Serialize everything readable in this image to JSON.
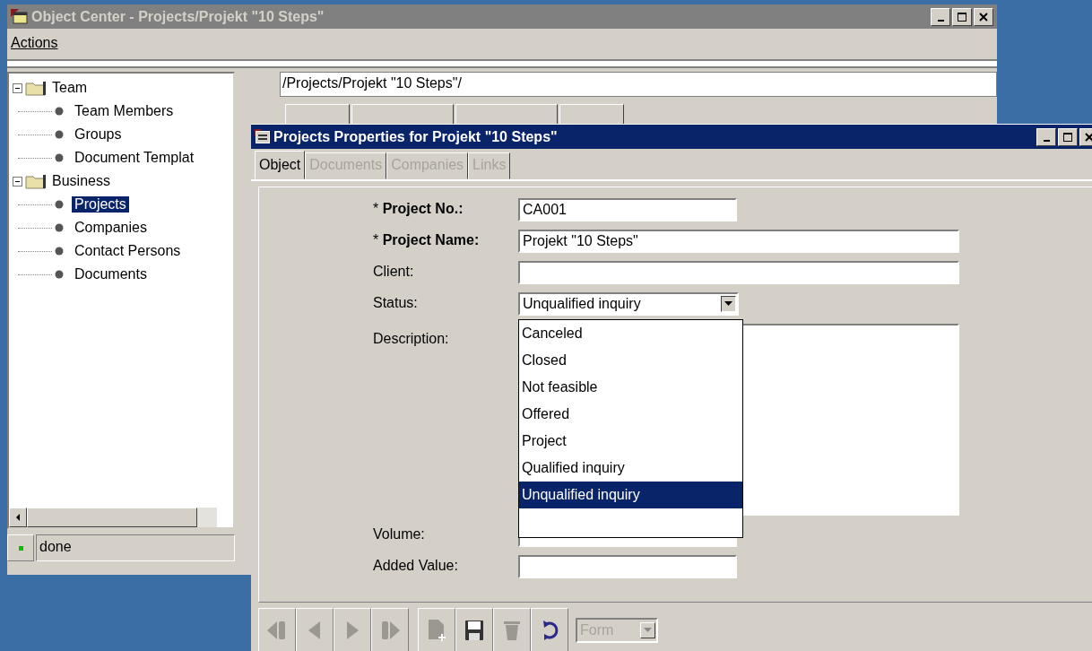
{
  "main_window": {
    "title": "Object Center  - Projects/Projekt \"10 Steps\"",
    "menu": [
      {
        "label": "Actions"
      }
    ],
    "tree": [
      {
        "label": "Team",
        "kind": "folder",
        "expanded": true,
        "selected": false,
        "children": [
          {
            "label": "Team Members",
            "kind": "leaf",
            "selected": false
          },
          {
            "label": "Groups",
            "kind": "leaf",
            "selected": false
          },
          {
            "label": "Document Templat",
            "kind": "leaf",
            "selected": false
          }
        ]
      },
      {
        "label": "Business",
        "kind": "folder",
        "expanded": true,
        "selected": false,
        "children": [
          {
            "label": "Projects",
            "kind": "leaf",
            "selected": true
          },
          {
            "label": "Companies",
            "kind": "leaf",
            "selected": false
          },
          {
            "label": "Contact Persons",
            "kind": "leaf",
            "selected": false
          },
          {
            "label": "Documents",
            "kind": "leaf",
            "selected": false
          }
        ]
      }
    ],
    "path": "/Projects/Projekt \"10 Steps\"/",
    "status": "done"
  },
  "dialog": {
    "title": "Projects Properties for Projekt \"10 Steps\"",
    "tabs": [
      {
        "label": "Object",
        "selected": true,
        "disabled": false
      },
      {
        "label": "Documents",
        "selected": false,
        "disabled": true
      },
      {
        "label": "Companies",
        "selected": false,
        "disabled": true
      },
      {
        "label": "Links",
        "selected": false,
        "disabled": true
      }
    ],
    "fields": [
      {
        "label": "* **Project No.:**",
        "kind": "text",
        "value": "CA001",
        "wide": false
      },
      {
        "label": "* **Project Name:**",
        "kind": "text",
        "value": "Projekt \"10 Steps\"",
        "wide": true
      },
      {
        "label": "Client:",
        "kind": "text",
        "wide": true
      },
      {
        "label": "Status:",
        "kind": "select",
        "value": "Unqualified inquiry",
        "expanded": true,
        "options": [
          {
            "label": "Canceled",
            "selected": false
          },
          {
            "label": "Closed",
            "selected": false
          },
          {
            "label": "Not feasible",
            "selected": false
          },
          {
            "label": "Offered",
            "selected": false
          },
          {
            "label": "Project",
            "selected": false
          },
          {
            "label": "Qualified inquiry",
            "selected": false
          },
          {
            "label": "Unqualified inquiry",
            "selected": true
          }
        ]
      },
      {
        "label": "Description:",
        "kind": "textarea"
      },
      {
        "label": "Volume:",
        "kind": "text",
        "wide": false
      },
      {
        "label": "Added Value:",
        "kind": "text",
        "wide": false
      }
    ],
    "toolbar": [
      {
        "kind": "first",
        "disabled": true
      },
      {
        "kind": "prev",
        "disabled": true
      },
      {
        "kind": "next",
        "disabled": true
      },
      {
        "kind": "last",
        "disabled": true
      },
      {
        "kind": "new",
        "disabled": true
      },
      {
        "kind": "save",
        "disabled": false
      },
      {
        "kind": "delete",
        "disabled": true
      },
      {
        "kind": "refresh",
        "disabled": false
      }
    ],
    "view_select": {
      "value": "Form",
      "disabled": true
    }
  }
}
